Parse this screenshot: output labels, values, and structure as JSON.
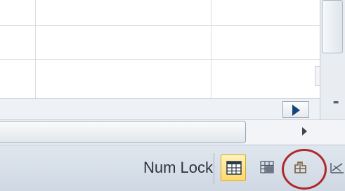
{
  "statusbar": {
    "mode_indicator": "Num Lock",
    "view_buttons": [
      {
        "name": "normal-view",
        "active": true
      },
      {
        "name": "page-layout-view",
        "active": false
      },
      {
        "name": "page-break-preview",
        "active": false
      },
      {
        "name": "zoom-view",
        "active": false
      }
    ]
  },
  "icons": {
    "sheet_nav_next": "triangle-right-icon",
    "scroll_right": "scroll-right-icon",
    "scroll_down": "scroll-down-icon",
    "normal_view": "normal-view-icon",
    "page_layout": "page-layout-icon",
    "page_break_preview": "page-break-preview-icon",
    "zoom": "zoom-icon"
  },
  "colors": {
    "active_button": "#ffd86a",
    "annotation_circle": "#b0282b",
    "sheet_nav_arrow": "#17437a"
  }
}
